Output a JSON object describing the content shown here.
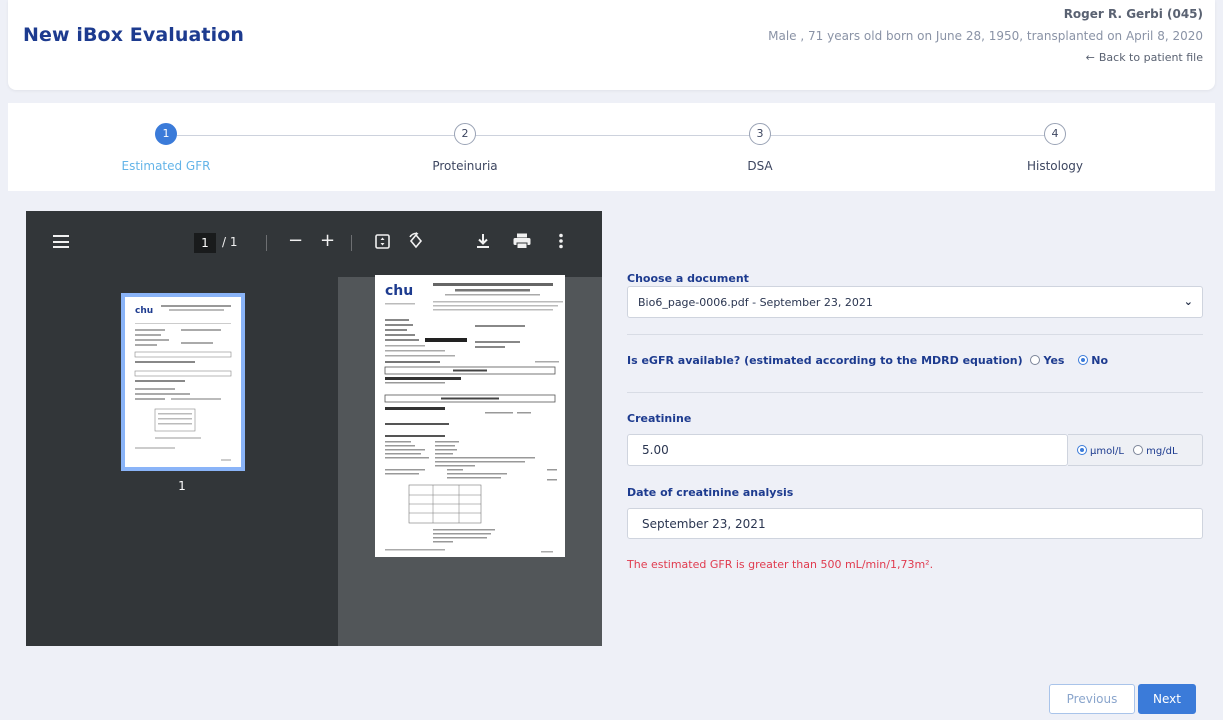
{
  "header": {
    "title": "New iBox Evaluation",
    "patient_name": "Roger R. Gerbi (045)",
    "patient_info": "Male , 71 years old born on June 28, 1950, transplanted on April 8, 2020",
    "back_link": "Back to patient file"
  },
  "stepper": {
    "steps": [
      {
        "number": "1",
        "label": "Estimated GFR",
        "active": true
      },
      {
        "number": "2",
        "label": "Proteinuria",
        "active": false
      },
      {
        "number": "3",
        "label": "DSA",
        "active": false
      },
      {
        "number": "4",
        "label": "Histology",
        "active": false
      }
    ]
  },
  "viewer": {
    "current_page": "1",
    "total_pages": "/ 1",
    "thumbnail_number": "1",
    "toolbar_icons": [
      "menu-icon",
      "zoom-out-icon",
      "zoom-in-icon",
      "fit-page-icon",
      "rotate-icon",
      "download-icon",
      "print-icon",
      "more-icon"
    ]
  },
  "form": {
    "document_label": "Choose a document",
    "document_value": "Bio6_page-0006.pdf - September 23, 2021",
    "egfr_question": "Is eGFR available? (estimated according to the MDRD equation)",
    "egfr_yes": "Yes",
    "egfr_no": "No",
    "egfr_selected": "No",
    "creatinine_label": "Creatinine",
    "creatinine_value": "5.00",
    "unit_umol": "µmol/L",
    "unit_mg": "mg/dL",
    "unit_selected": "µmol/L",
    "date_label": "Date of creatinine analysis",
    "date_value": "September 23, 2021",
    "warning": "The estimated GFR is greater than 500 mL/min/1,73m²."
  },
  "nav": {
    "previous": "Previous",
    "next": "Next"
  },
  "colors": {
    "accent": "#3b7bd9",
    "title": "#1d3b8f",
    "warning": "#e03b4f",
    "active_step_label": "#64b4e8"
  }
}
